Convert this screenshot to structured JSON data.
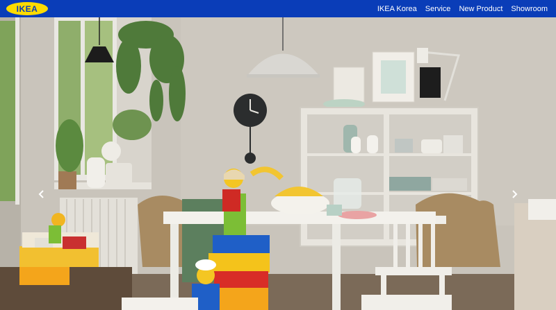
{
  "brand": {
    "logo_text": "IKEA"
  },
  "nav": {
    "items": [
      {
        "label": "IKEA Korea"
      },
      {
        "label": "Service"
      },
      {
        "label": "New Product"
      },
      {
        "label": "Showroom"
      }
    ]
  },
  "hero": {
    "image": "interior-scene-kitchen-lego",
    "prev_icon": "chevron-left-icon",
    "next_icon": "chevron-right-icon"
  },
  "colors": {
    "nav_bg": "#0a3db8",
    "logo_yellow": "#fedb00",
    "logo_blue": "#0a3db8"
  }
}
